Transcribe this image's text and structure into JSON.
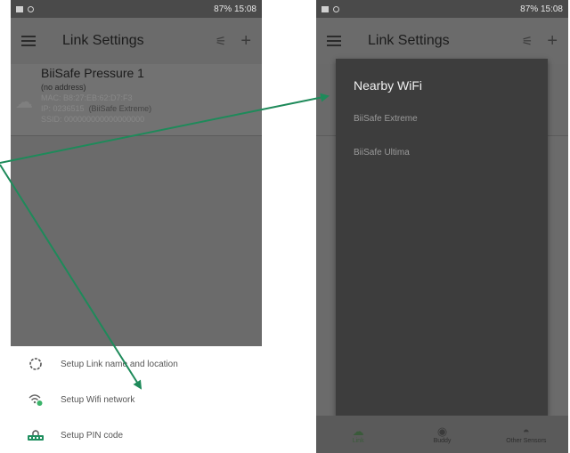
{
  "status_bar": {
    "right_text": "87% 15:08"
  },
  "left_screen": {
    "title": "Link Settings",
    "device": {
      "name": "BiiSafe Pressure 1",
      "address": "(no address)",
      "mac": "MAC: B8:27:EB:62:D7:F3",
      "ip": "IP: 0236515",
      "ip_note": "(BiiSafe Extreme)",
      "extra": "SSID: 000000000000000000"
    },
    "sheet_items": [
      {
        "icon": "circle-outline-icon",
        "label": "Setup Link name and location"
      },
      {
        "icon": "wifi-settings-icon",
        "label": "Setup Wifi network"
      },
      {
        "icon": "pin-code-icon",
        "label": "Setup PIN code"
      }
    ]
  },
  "right_screen": {
    "title": "Link Settings",
    "dialog": {
      "title": "Nearby WiFi",
      "items": [
        "BiiSafe Extreme",
        "BiiSafe Ultima"
      ]
    },
    "nav": [
      {
        "label": "Link",
        "icon": "link-icon"
      },
      {
        "label": "Buddy",
        "icon": "buddy-icon"
      },
      {
        "label": "Other Sensors",
        "icon": "sensors-icon"
      }
    ]
  },
  "colors": {
    "arrow": "#1e8a5a",
    "overlay_dark": "#6b6b6b",
    "wifi_badge": "#3bb36a",
    "pin_icon": "#1f8f5f"
  }
}
